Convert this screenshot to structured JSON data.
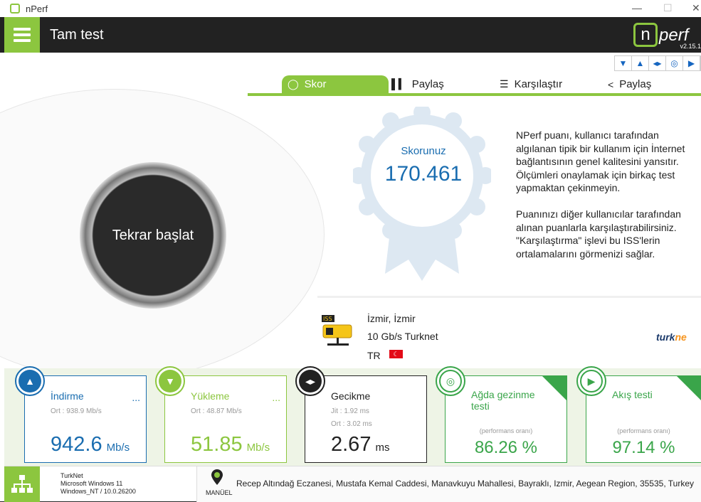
{
  "window": {
    "title": "nPerf"
  },
  "header": {
    "title": "Tam test",
    "brand": "perf",
    "brand_n": "n",
    "version": "v2.15.1"
  },
  "tabs": [
    {
      "label": "Skor",
      "icon": "bulb-icon"
    },
    {
      "label": "Paylaş",
      "icon": "bar-chart-icon"
    },
    {
      "label": "Karşılaştır",
      "icon": "compare-icon"
    },
    {
      "label": "Paylaş",
      "icon": "share-icon"
    }
  ],
  "main": {
    "restart_label": "Tekrar başlat",
    "score_label": "Skorunuz",
    "score_value": "170.461",
    "description": "NPerf puanı, kullanıcı tarafından\nalgılanan tipik bir kullanım için İnternet\nbağlantısının genel kalitesini yansıtır.\nÖlçümleri onaylamak için birkaç test\nyapmaktan çekinmeyin.\n\n Puanınızı diğer kullanıcılar tarafından\nalınan puanlarla karşılaştırabilirsiniz.\n\"Karşılaştırma\" işlevi bu ISS'lerin\nortalamalarını görmenizi sağlar."
  },
  "isp": {
    "city": "İzmir, İzmir",
    "plan": "10 Gb/s Turknet",
    "country": "TR",
    "logo_text_a": "turk",
    "logo_text_b": "ne"
  },
  "cards": {
    "download": {
      "title": "İndirme",
      "avg": "Ort : 938.9 Mb/s",
      "value": "942.6",
      "unit": "Mb/s",
      "more": "..."
    },
    "upload": {
      "title": "Yükleme",
      "avg": "Ort : 48.87 Mb/s",
      "value": "51.85",
      "unit": "Mb/s",
      "more": "..."
    },
    "latency": {
      "title": "Gecikme",
      "jitter": "Jit : 1.92 ms",
      "avg": "Ort : 3.02 ms",
      "value": "2.67",
      "unit": "ms"
    },
    "browsing": {
      "title": "Ağda gezinme testi",
      "note": "(performans oranı)",
      "value": "86.26 %"
    },
    "streaming": {
      "title": "Akış testi",
      "note": "(performans oranı)",
      "value": "97.14 %"
    }
  },
  "footer": {
    "isp": "TurkNet",
    "os": "Microsoft Windows 11",
    "os_version": "Windows_NT / 10.0.26200",
    "mode": "MANÜEL",
    "address": "Recep Altındağ Eczanesi, Mustafa Kemal Caddesi, Manavkuyu Mahallesi, Bayraklı, Izmir, Aegean Region, 35535, Turkey"
  },
  "colors": {
    "accent": "#8cc63f",
    "blue": "#1a6db0",
    "green": "#3aa54a",
    "lime": "#8cc63f"
  }
}
